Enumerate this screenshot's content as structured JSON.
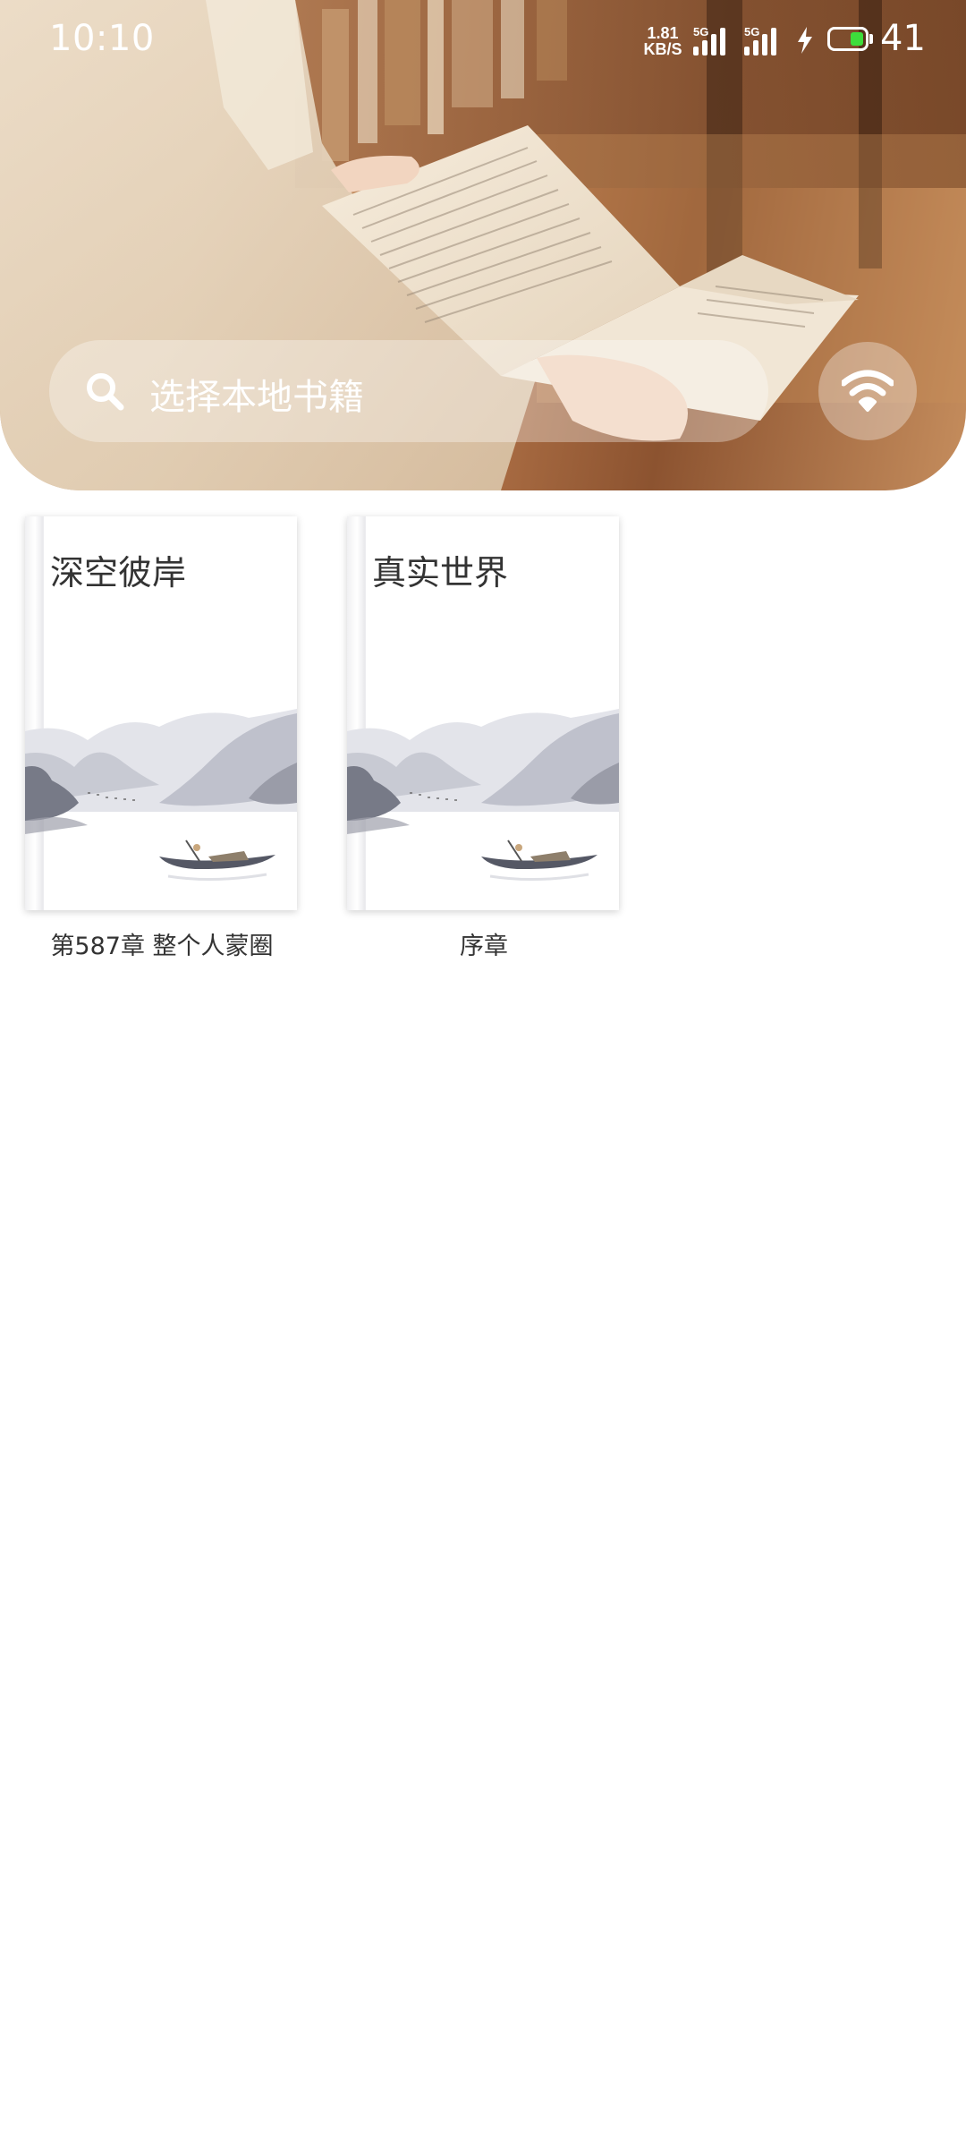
{
  "status_bar": {
    "time": "10:10",
    "net_speed_value": "1.81",
    "net_speed_unit": "KB/S",
    "sim1_generation": "5G",
    "sim2_generation": "5G",
    "battery_level": "41",
    "battery_fraction": 0.41,
    "charging": true
  },
  "search": {
    "placeholder": "选择本地书籍",
    "icon": "search-icon"
  },
  "wifi_button": {
    "icon": "wifi-icon"
  },
  "books": [
    {
      "title": "深空彼岸",
      "chapter": "第587章 整个人蒙圈"
    },
    {
      "title": "真实世界",
      "chapter": "序章"
    }
  ],
  "colors": {
    "battery_fill": "#3ddc3b",
    "text_dark": "#333333",
    "overlay_white": "rgba(255,255,255,0.33)"
  }
}
